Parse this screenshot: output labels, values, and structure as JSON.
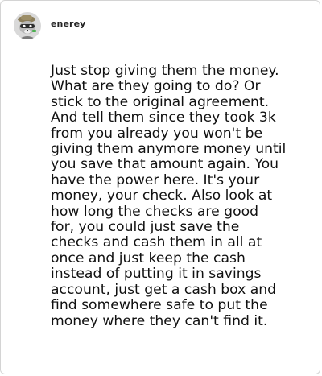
{
  "post": {
    "username": "enerey",
    "avatar_icon": "raccoon-with-hat-avatar-icon",
    "body": "Just stop giving them the money.\nWhat are they going to do? Or\nstick to the original agreement.\nAnd tell them since they took 3k\nfrom you already you won't be\ngiving them anymore money until\nyou save that amount again. You\nhave the power here. It's your\nmoney, your check. Also look at\nhow long the checks are good\nfor, you could just save the\nchecks and cash them in all at\nonce and just keep the cash\ninstead of putting it in savings\naccount, just get a cash box and\nfind somewhere safe to put the\nmoney where they can't find it."
  }
}
